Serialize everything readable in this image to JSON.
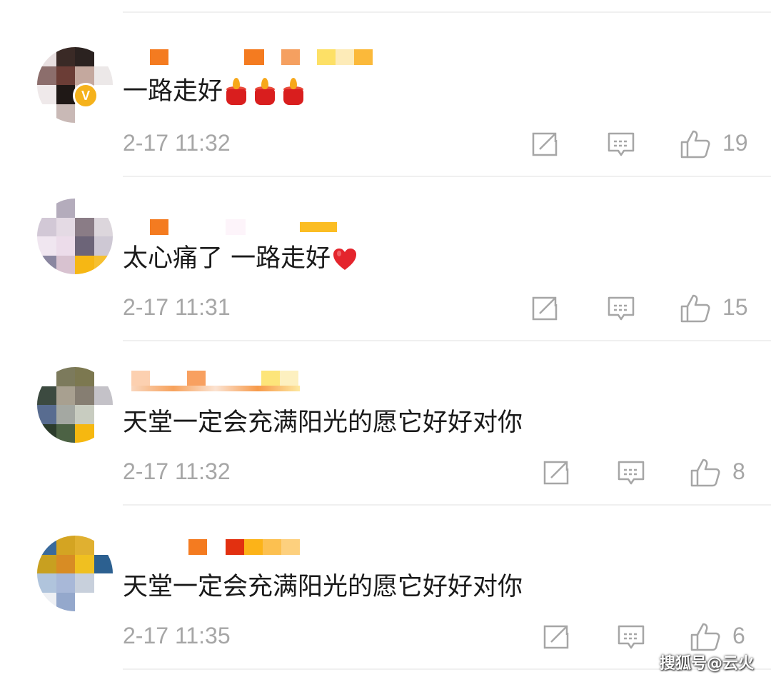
{
  "comments": [
    {
      "text": "一路走好",
      "emoji": "candle-emoji",
      "time": "2-17 11:32",
      "likes": "19",
      "verified": true
    },
    {
      "text": "太心痛了 一路走好",
      "emoji": "heart-emoji",
      "time": "2-17 11:31",
      "likes": "15",
      "verified": false
    },
    {
      "text": "天堂一定会充满阳光的愿它好好对你",
      "emoji": "",
      "time": "2-17 11:32",
      "likes": "8",
      "verified": false
    },
    {
      "text": "天堂一定会充满阳光的愿它好好对你",
      "emoji": "",
      "time": "2-17 11:35",
      "likes": "6",
      "verified": false
    }
  ],
  "icons": {
    "share": "share-icon",
    "reply": "reply-icon",
    "like": "like-icon"
  },
  "colors": {
    "text": "#1a1a1a",
    "meta": "#a6a6a6",
    "username_mosaic": "#f47b20",
    "divider": "#f0f0f0"
  },
  "watermark": "搜狐号@云火"
}
